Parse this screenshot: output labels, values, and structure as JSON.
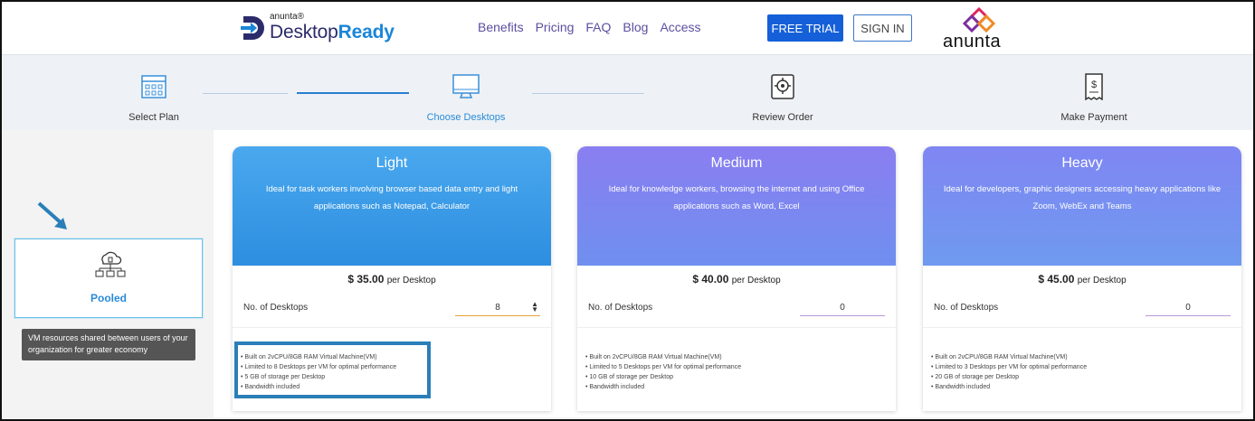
{
  "header": {
    "logo_small": "anunta®",
    "logo_desktop": "Desktop",
    "logo_ready": "Ready",
    "nav": [
      "Benefits",
      "Pricing",
      "FAQ",
      "Blog",
      "Access"
    ],
    "free_trial_label": "FREE TRIAL",
    "sign_in_label": "SIGN IN",
    "brand_logo_text": "anunta"
  },
  "stepper": {
    "steps": [
      {
        "label": "Select Plan",
        "icon": "plan-grid-icon",
        "active": false
      },
      {
        "label": "Choose Desktops",
        "icon": "monitor-icon",
        "active": true
      },
      {
        "label": "Review Order",
        "icon": "review-gear-icon",
        "active": false
      },
      {
        "label": "Make Payment",
        "icon": "receipt-dollar-icon",
        "active": false
      }
    ]
  },
  "sidebar": {
    "pooled_label": "Pooled",
    "pooled_icon": "cloud-network-icon",
    "tooltip": "VM resources shared between users of your organization for greater economy"
  },
  "plans": [
    {
      "title": "Light",
      "description": "Ideal for task workers involving browser based data entry and light applications such as Notepad, Calculator",
      "price": "$ 35.00",
      "per": "per Desktop",
      "qty_label": "No. of Desktops",
      "qty_value": "8",
      "features": [
        "Built on 2vCPU/8GB RAM Virtual Machine(VM)",
        "Limited to 8 Desktops per VM for optimal performance",
        "5 GB of storage per Desktop",
        "Bandwidth included"
      ]
    },
    {
      "title": "Medium",
      "description": "Ideal for knowledge workers, browsing the internet and using Office applications such as Word, Excel",
      "price": "$ 40.00",
      "per": "per Desktop",
      "qty_label": "No. of Desktops",
      "qty_value": "0",
      "features": [
        "Built on 2vCPU/8GB RAM Virtual Machine(VM)",
        "Limited to 5 Desktops per VM for optimal performance",
        "10 GB of storage per Desktop",
        "Bandwidth included"
      ]
    },
    {
      "title": "Heavy",
      "description": "Ideal for developers, graphic designers accessing heavy applications like Zoom, WebEx and Teams",
      "price": "$ 45.00",
      "per": "per Desktop",
      "qty_label": "No. of Desktops",
      "qty_value": "0",
      "features": [
        "Built on 2vCPU/8GB RAM Virtual Machine(VM)",
        "Limited to 3 Desktops per VM for optimal performance",
        "20 GB of storage per Desktop",
        "Bandwidth included"
      ]
    }
  ],
  "colors": {
    "accent_blue": "#1560d8",
    "active_step": "#2a8ad8",
    "nav_text": "#5b4fa0",
    "highlight_border": "#2a7fb8"
  }
}
